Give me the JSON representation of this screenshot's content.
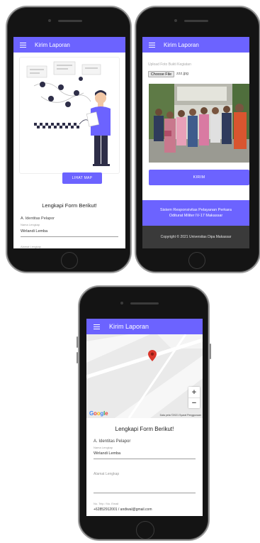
{
  "colors": {
    "accent": "#6c63ff",
    "footer_dark": "#3a3a3a"
  },
  "screen1": {
    "app_title": "Kirim Laporan",
    "map_button": "LIHAT MAP",
    "form_title": "Lengkapi Form Berikut!",
    "section": "A. Identitas Pelapor",
    "name_label": "Nama Lengkap",
    "name_value": "Wirlandi Lemba",
    "address_label": "Alamat Lengkap"
  },
  "screen2": {
    "app_title": "Kirim Laporan",
    "upload_label": "Upload Foto Bukti Kegiatan",
    "file_button": "Choose File",
    "file_name": "zzz.jpg",
    "submit_button": "KIRIM",
    "footer_line1": "Sistem Responsivitas Pelayanan Perkara",
    "footer_line2": "Oditurat Militer IV-17 Makassar",
    "copyright": "Copyright © 2021 Universitas Dipa Makassar"
  },
  "screen3": {
    "app_title": "Kirim Laporan",
    "map_attribution": "Data peta ©2021   Syarat Penggunaan",
    "google_logo": "Google",
    "zoom_in": "+",
    "zoom_out": "−",
    "form_title": "Lengkapi Form Berikut!",
    "section": "A. Identitas Pelapor",
    "name_label": "Nama Lengkap",
    "name_value": "Wirlandi Lemba",
    "address_label": "Alamat Lengkap",
    "phone_label": "No. Telp / No. Email",
    "phone_value": "+62852912001 / andiwal@gmail.com"
  },
  "icons": [
    "menu-icon",
    "map-pin-icon"
  ]
}
